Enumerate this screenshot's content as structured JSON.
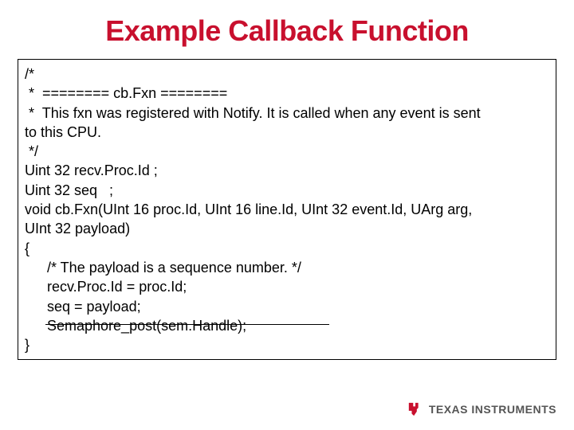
{
  "title": "Example Callback Function",
  "code": {
    "l0": "/*",
    "l1": " *  ======== cb.Fxn ========",
    "l2": " *  This fxn was registered with Notify. It is called when any event is sent",
    "l3": "to this CPU.",
    "l4": " */",
    "l5": "Uint 32 recv.Proc.Id ;",
    "l6": "Uint 32 seq   ;",
    "l7": "void cb.Fxn(UInt 16 proc.Id, UInt 16 line.Id, UInt 32 event.Id, UArg arg,",
    "l8": "UInt 32 payload)",
    "l9": "{",
    "l10": "/* The payload is a sequence number. */",
    "l11": "recv.Proc.Id = proc.Id;",
    "l12": "seq = payload;",
    "l13": "Semaphore_post(sem.Handle);",
    "l14": "}"
  },
  "footer": {
    "brand": "TEXAS INSTRUMENTS"
  }
}
